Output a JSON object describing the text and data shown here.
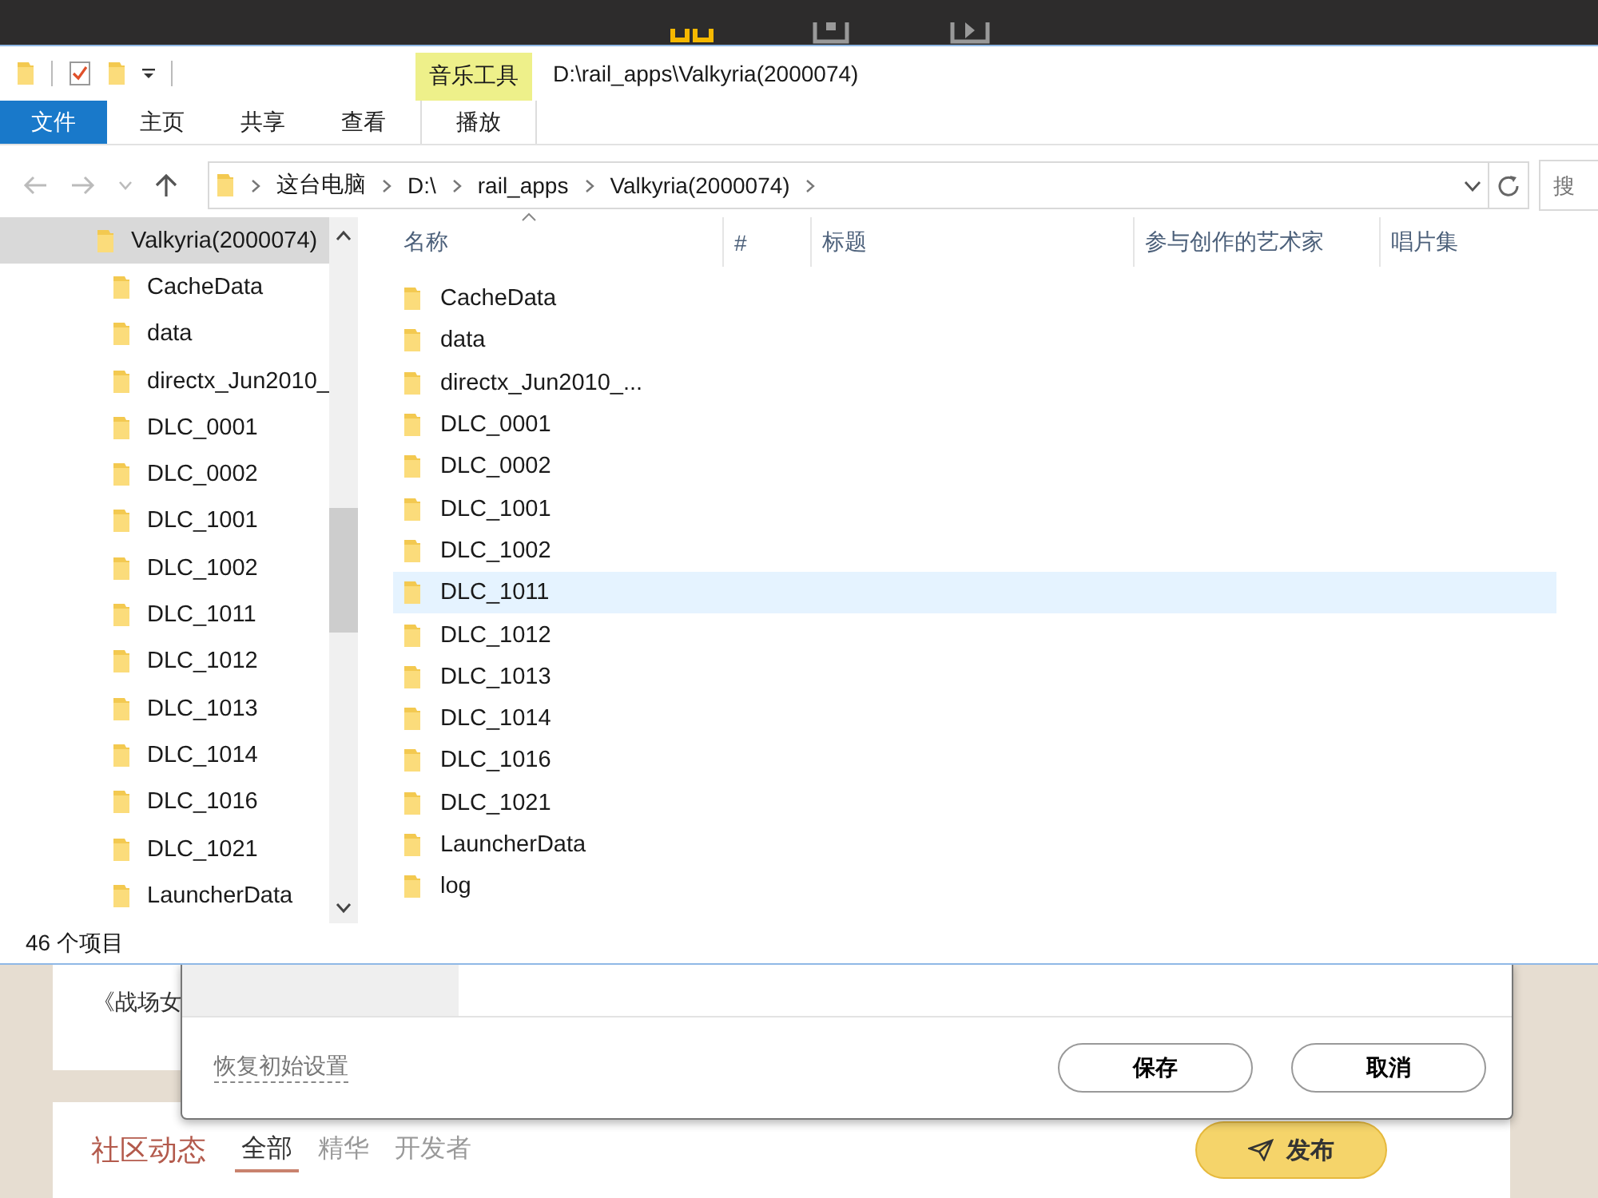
{
  "window": {
    "title": "D:\\rail_apps\\Valkyria(2000074)"
  },
  "ribbon": {
    "file_tab": "文件",
    "tabs": [
      "主页",
      "共享",
      "查看"
    ],
    "contextual": {
      "group": "音乐工具",
      "tabs": [
        "播放"
      ]
    }
  },
  "address_bar": {
    "crumbs": [
      "这台电脑",
      "D:\\",
      "rail_apps",
      "Valkyria(2000074)"
    ]
  },
  "search": {
    "placeholder": "搜"
  },
  "nav_tree": [
    {
      "label": "Valkyria(2000074)",
      "selected": true,
      "children": [
        {
          "label": "CacheData",
          "selected": false
        },
        {
          "label": "data",
          "selected": false
        },
        {
          "label": "directx_Jun2010_",
          "selected": false
        },
        {
          "label": "DLC_0001",
          "selected": false
        },
        {
          "label": "DLC_0002",
          "selected": false
        },
        {
          "label": "DLC_1001",
          "selected": false
        },
        {
          "label": "DLC_1002",
          "selected": false
        },
        {
          "label": "DLC_1011",
          "selected": false
        },
        {
          "label": "DLC_1012",
          "selected": false
        },
        {
          "label": "DLC_1013",
          "selected": false
        },
        {
          "label": "DLC_1014",
          "selected": false
        },
        {
          "label": "DLC_1016",
          "selected": false
        },
        {
          "label": "DLC_1021",
          "selected": false
        },
        {
          "label": "LauncherData",
          "selected": false
        }
      ]
    }
  ],
  "file_list": {
    "columns": [
      "名称",
      "#",
      "标题",
      "参与创作的艺术家",
      "唱片集"
    ],
    "rows": [
      {
        "name": "CacheData",
        "selected": false
      },
      {
        "name": "data",
        "selected": false
      },
      {
        "name": "directx_Jun2010_...",
        "selected": false
      },
      {
        "name": "DLC_0001",
        "selected": false
      },
      {
        "name": "DLC_0002",
        "selected": false
      },
      {
        "name": "DLC_1001",
        "selected": false
      },
      {
        "name": "DLC_1002",
        "selected": false
      },
      {
        "name": "DLC_1011",
        "selected": true
      },
      {
        "name": "DLC_1012",
        "selected": false
      },
      {
        "name": "DLC_1013",
        "selected": false
      },
      {
        "name": "DLC_1014",
        "selected": false
      },
      {
        "name": "DLC_1016",
        "selected": false
      },
      {
        "name": "DLC_1021",
        "selected": false
      },
      {
        "name": "LauncherData",
        "selected": false
      },
      {
        "name": "log",
        "selected": false
      }
    ]
  },
  "status_bar": {
    "count": "46 个项目"
  },
  "background_app": {
    "card_text": "《战场女",
    "dialog": {
      "reset_link": "恢复初始设置",
      "buttons": [
        "保存",
        "取消"
      ]
    },
    "community": {
      "title": "社区动态",
      "tabs": [
        {
          "label": "全部",
          "selected": true
        },
        {
          "label": "精华",
          "selected": false
        },
        {
          "label": "开发者",
          "selected": false
        }
      ],
      "post_button": "发布"
    }
  }
}
